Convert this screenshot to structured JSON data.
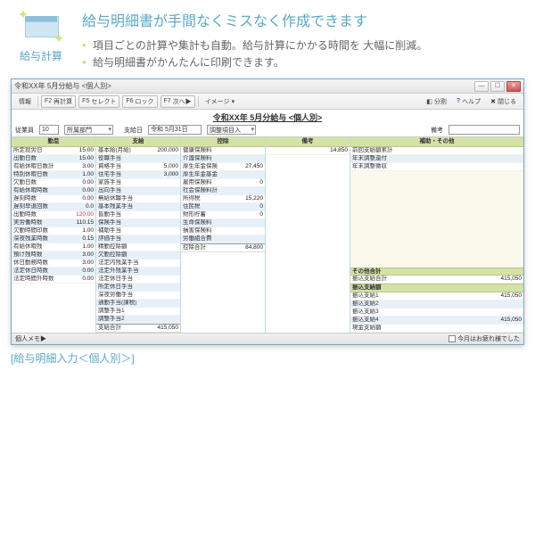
{
  "hero": {
    "icon_label": "給与計算",
    "title": "給与明細書が手間なくミスなく作成できます",
    "bullets": [
      "項目ごとの計算や集計も自動。給与計算にかかる時間を\n大幅に削減。",
      "給与明細書がかんたんに印刷できます。"
    ]
  },
  "window": {
    "title": "令和XX年 5月分給与 <個人別>",
    "subtitle": "令和XX年 5月分給与 <個人別>",
    "toolbar": {
      "info": "情報",
      "f2": "F2",
      "recalc": "再計算",
      "f5": "F5",
      "select": "セレクト",
      "f6": "F6",
      "lock": "ロック",
      "f7": "F7",
      "next": "次へ▶",
      "image": "イメージ",
      "split": "分割",
      "help": "ヘルプ",
      "close": "閉じる"
    },
    "controls": {
      "emp_code_lbl": "従業員",
      "emp_code": "10",
      "emp_name": "所属部門",
      "pay_date_lbl": "支給日",
      "pay_date": "令和 5月31日",
      "calc_lbl": "調整項目入",
      "memo_lbl": "備考"
    },
    "col1_hdr": "勤怠",
    "col1": [
      {
        "l": "所定就労日",
        "r": "15.00"
      },
      {
        "l": "出勤日数",
        "r": "15.00"
      },
      {
        "l": "有給休暇日数計",
        "r": "3.00"
      },
      {
        "l": "特別休暇日数",
        "r": "1.00"
      },
      {
        "l": "欠勤日数",
        "r": "0.00"
      },
      {
        "l": "有給休暇時数",
        "r": "0.00"
      },
      {
        "l": "遅刻時数",
        "r": "0.00"
      },
      {
        "l": "遅刻早退回数",
        "r": "0.0"
      },
      {
        "l": "出勤時数",
        "r": "120.00",
        "red": true
      },
      {
        "l": "実労働時数",
        "r": "110.15"
      },
      {
        "l": "欠勤時間印数",
        "r": "1.00"
      },
      {
        "l": "深夜残業時数",
        "r": "0.15"
      },
      {
        "l": "有給休暇残",
        "r": "1.00"
      },
      {
        "l": "預け残時数",
        "r": "3.00"
      },
      {
        "l": "休日勤務時数",
        "r": "3.00"
      },
      {
        "l": "法定休日時数",
        "r": "0.00"
      },
      {
        "l": "法定時間外時数",
        "r": "0.00"
      }
    ],
    "col2_hdr": "支給",
    "col2": [
      {
        "l": "基本給(月給)",
        "r": "200,000"
      },
      {
        "l": "役職手当",
        "r": ""
      },
      {
        "l": "資格手当",
        "r": "5,000"
      },
      {
        "l": "住宅手当",
        "r": "3,000"
      },
      {
        "l": "家族手当",
        "r": ""
      },
      {
        "l": "出向手当",
        "r": ""
      },
      {
        "l": "無給休職手当",
        "r": ""
      },
      {
        "l": "基本残業手当",
        "r": ""
      },
      {
        "l": "皆勤手当",
        "r": ""
      },
      {
        "l": "保険手当",
        "r": ""
      },
      {
        "l": "補助手当",
        "r": ""
      },
      {
        "l": "評価手当",
        "r": ""
      },
      {
        "l": "精勤控除額",
        "r": ""
      },
      {
        "l": "欠勤控除額",
        "r": ""
      },
      {
        "l": "法定内残業手当",
        "r": ""
      },
      {
        "l": "法定外残業手当",
        "r": ""
      },
      {
        "l": "法定休日手当",
        "r": ""
      },
      {
        "l": "所定休日手当",
        "r": ""
      },
      {
        "l": "深夜労働手当",
        "r": ""
      },
      {
        "l": "通勤手当(課税)",
        "r": ""
      },
      {
        "l": "調整手当1",
        "r": ""
      },
      {
        "l": "調整手当2",
        "r": ""
      }
    ],
    "col2_total": {
      "l": "支給合計",
      "r": "415,050"
    },
    "col3_hdr": "控除",
    "col3": [
      {
        "l": "健康保険料",
        "r": ""
      },
      {
        "l": "介護保険料",
        "r": ""
      },
      {
        "l": "厚生年金保険",
        "r": "27,450"
      },
      {
        "l": "厚生年金基金",
        "r": ""
      },
      {
        "l": "雇用保険料",
        "r": "0"
      },
      {
        "l": "社会保険料計",
        "r": ""
      },
      {
        "l": "所得税",
        "r": "15,220"
      },
      {
        "l": "住民税",
        "r": "0"
      },
      {
        "l": "財形貯蓄",
        "r": "0"
      },
      {
        "l": "生命保険料",
        "r": ""
      },
      {
        "l": "損害保険料",
        "r": ""
      },
      {
        "l": "労働組合費",
        "r": ""
      }
    ],
    "col3_total": {
      "l": "控除合計",
      "r": "84,800"
    },
    "col4_hdr": "備考",
    "col4": [
      {
        "l": "",
        "r": "14,850"
      }
    ],
    "col5_hdr": "補助・その他",
    "col5_top": [
      {
        "l": "前回支給額累計",
        "r": ""
      },
      {
        "l": "年末調整還付",
        "r": ""
      },
      {
        "l": "年末調整徴収",
        "r": ""
      }
    ],
    "col5_mid_hdr": "その他合計",
    "col5_mid": [
      {
        "l": "振込支給合計",
        "r": "415,050"
      }
    ],
    "col5_bot_hdr": "振込支給額",
    "col5_bot": [
      {
        "l": "振込支給1",
        "r": "415,050"
      },
      {
        "l": "振込支給2",
        "r": ""
      },
      {
        "l": "振込支給3",
        "r": ""
      },
      {
        "l": "振込支給4",
        "r": "415,050"
      },
      {
        "l": "現金支給額",
        "r": ""
      }
    ],
    "status": {
      "left_lbl": "個人メモ▶",
      "chk_lbl": "今月はお疲れ様でした"
    }
  },
  "caption": "[給与明細入力＜個人別＞]"
}
